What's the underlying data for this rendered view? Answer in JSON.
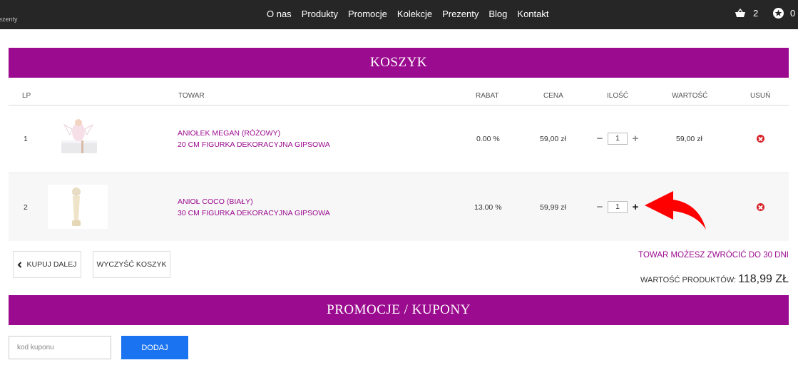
{
  "header": {
    "brand_fragment": "ezenty",
    "nav": [
      "O nas",
      "Produkty",
      "Promocje",
      "Kolekcje",
      "Prezenty",
      "Blog",
      "Kontakt"
    ],
    "basket_count": "2",
    "favorites_count": "0"
  },
  "cart": {
    "title": "KOSZYK",
    "columns": {
      "lp": "LP",
      "product": "TOWAR",
      "discount": "RABAT",
      "price": "CENA",
      "quantity": "ILOŚĆ",
      "value": "WARTOŚĆ",
      "remove": "USUŃ"
    },
    "items": [
      {
        "lp": "1",
        "name_line1": "ANIOŁEK MEGAN (RÓŻOWY)",
        "name_line2": "20 CM FIGURKA DEKORACYJNA GIPSOWA",
        "discount": "0.00 %",
        "price": "59,00 zł",
        "quantity": "1",
        "value": "59,00 zł"
      },
      {
        "lp": "2",
        "name_line1": "ANIOŁ COCO (BIAŁY)",
        "name_line2": "30 CM FIGURKA DEKORACYJNA GIPSOWA",
        "discount": "13.00 %",
        "price": "59,99 zł",
        "quantity": "1",
        "value": ""
      }
    ],
    "continue_label": "KUPUJ DALEJ",
    "clear_label": "WYCZYŚĆ KOSZYK",
    "return_note": "TOWAR MOŻESZ ZWRÓCIĆ DO 30 DNI",
    "total_label": "WARTOŚĆ PRODUKTÓW:",
    "total_value": "118,99 ZŁ"
  },
  "promotions": {
    "title": "PROMOCJE / KUPONY",
    "coupon_placeholder": "kod kuponu",
    "add_label": "DODAJ"
  },
  "colors": {
    "accent": "#9b0b8f",
    "topbar": "#262626",
    "button_blue": "#1a73f0",
    "remove_red": "#d8232a",
    "annotation_arrow": "#ff0000"
  },
  "icons": [
    "basket-icon",
    "star-icon",
    "chevron-left-icon",
    "remove-icon",
    "minus-icon",
    "plus-icon",
    "red-arrow-annotation"
  ]
}
